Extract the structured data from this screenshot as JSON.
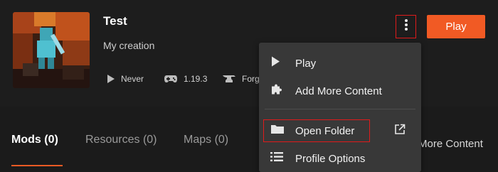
{
  "profile": {
    "title": "Test",
    "subtitle": "My creation",
    "meta": [
      {
        "icon": "play-icon",
        "label": "Never"
      },
      {
        "icon": "gamepad-icon",
        "label": "1.19.3"
      },
      {
        "icon": "anvil-icon",
        "label": "Forge"
      }
    ]
  },
  "actions": {
    "kebab_icon": "more-vertical-icon",
    "play_label": "Play",
    "accent": "#f15a24"
  },
  "tabs": [
    {
      "label": "Mods",
      "count": "(0)",
      "active": true
    },
    {
      "label": "Resources",
      "count": "(0)"
    },
    {
      "label": "Maps",
      "count": "(0)"
    }
  ],
  "more_content_label": "More Content",
  "menu": {
    "items": [
      {
        "icon": "play-icon",
        "label": "Play"
      },
      {
        "icon": "puzzle-icon",
        "label": "Add More Content"
      },
      {
        "icon": "folder-icon",
        "label": "Open Folder",
        "trailing_icon": "external-link-icon"
      },
      {
        "icon": "list-icon",
        "label": "Profile Options"
      }
    ]
  },
  "highlight_color": "#e01b1b"
}
